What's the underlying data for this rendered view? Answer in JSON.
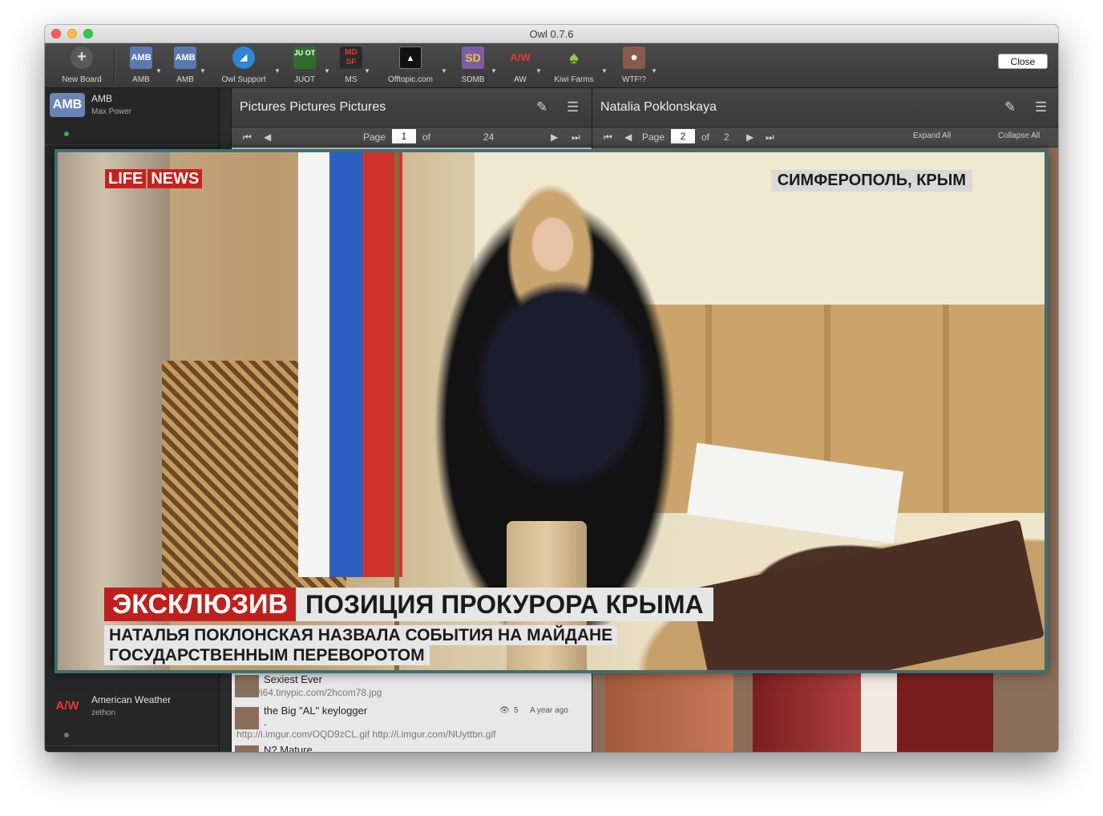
{
  "window": {
    "title": "Owl 0.7.6"
  },
  "toolbar": {
    "items": [
      {
        "label": "New Board"
      },
      {
        "label": "AMB",
        "icon_text": "AMB"
      },
      {
        "label": "AMB",
        "icon_text": "AMB"
      },
      {
        "label": "Owl Support"
      },
      {
        "label": "JUOT",
        "icon_text": "JU OT"
      },
      {
        "label": "MS",
        "icon_text": "MD SF"
      },
      {
        "label": "Offtopic.com"
      },
      {
        "label": "SDMB",
        "icon_text": "SD"
      },
      {
        "label": "AW",
        "icon_text": "A/W"
      },
      {
        "label": "Kiwi Farms"
      },
      {
        "label": "WTF!?"
      }
    ],
    "close_label": "Close"
  },
  "sidebar": {
    "boards": [
      {
        "name": "AMB",
        "user": "Max Power",
        "icon_text": "AMB"
      },
      {
        "name": "American Weather",
        "user": "zethon",
        "icon_text": "A/W"
      }
    ]
  },
  "left_panel": {
    "title": "Pictures Pictures Pictures",
    "pager": {
      "page_label": "Page",
      "page": "1",
      "of_label": "of",
      "total": "24"
    },
    "posts": [
      {
        "title": "Sexiest Ever",
        "link": "http://i64.tinypic.com/2hcom78.jpg"
      },
      {
        "title": "the Big \"AL\" keylogger",
        "body": ".",
        "link": "http://i.imgur.com/OQD9zCL.gif http://i.imgur.com/NUyttbn.gif",
        "views": "5",
        "time": "A year ago"
      },
      {
        "title": "N? Mature"
      }
    ]
  },
  "right_panel": {
    "title": "Natalia Poklonskaya",
    "pager": {
      "page_label": "Page",
      "page": "2",
      "of_label": "of",
      "total": "2"
    },
    "expand_label": "Expand All",
    "collapse_label": "Collapse All"
  },
  "viewer": {
    "logo_part1": "LIFE",
    "logo_part2": "NEWS",
    "location": "СИМФЕРОПОЛЬ, КРЫМ",
    "tag": "ЭКСКЛЮЗИВ",
    "headline": "ПОЗИЦИЯ ПРОКУРОРА КРЫМА",
    "subline1": "НАТАЛЬЯ ПОКЛОНСКАЯ НАЗВАЛА СОБЫТИЯ НА МАЙДАНЕ",
    "subline2": "ГОСУДАРСТВЕННЫМ ПЕРЕВОРОТОМ"
  },
  "colors": {
    "accent_red": "#c0201d",
    "overlay_border": "#3e6f71",
    "status_green": "#2fb14a"
  }
}
